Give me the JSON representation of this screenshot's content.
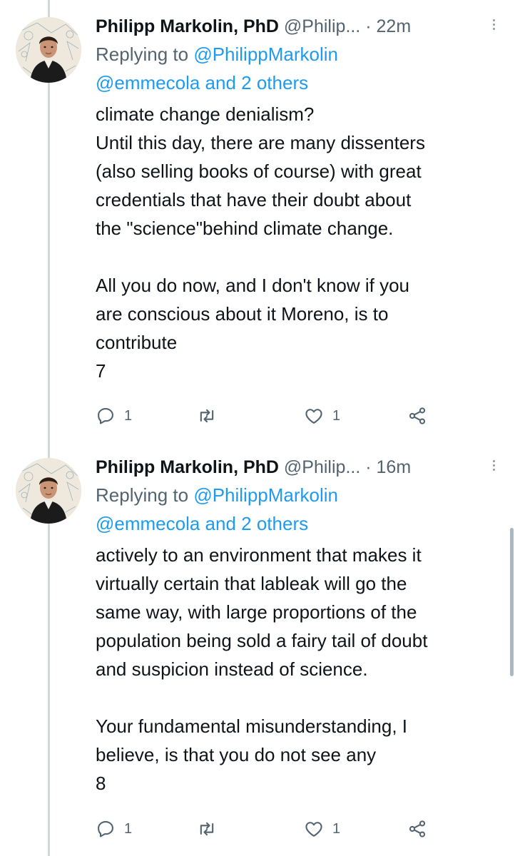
{
  "tweets": [
    {
      "author": {
        "name": "Philipp Markolin, PhD",
        "handle": "@Philip...",
        "time": "22m",
        "dot": "·"
      },
      "reply": {
        "prefix": "Replying to",
        "to": "@PhilippMarkolin",
        "mentions": "@emmecola and 2 others"
      },
      "lines": [
        "climate change denialism?",
        "Until this day, there are many dissenters",
        "(also selling books of course) with great",
        "credentials that have their doubt about",
        "the \"science\"behind climate change.",
        "",
        "All you do now, and I don't know if you",
        "are conscious about it Moreno, is to",
        "contribute",
        "7"
      ],
      "actions": {
        "replies": "1",
        "retweets": "",
        "likes": "1"
      }
    },
    {
      "author": {
        "name": "Philipp Markolin, PhD",
        "handle": "@Philip...",
        "time": "16m",
        "dot": "·"
      },
      "reply": {
        "prefix": "Replying to",
        "to": "@PhilippMarkolin",
        "mentions": "@emmecola and 2 others"
      },
      "lines": [
        "actively to an environment that makes it",
        "virtually certain that lableak will go the",
        "same way, with large proportions of the",
        "population being sold a fairy tail of doubt",
        "and suspicion instead of science.",
        "",
        "Your fundamental misunderstanding, I",
        "believe, is that you do not see any",
        "8"
      ],
      "actions": {
        "replies": "1",
        "retweets": "",
        "likes": "1"
      }
    }
  ],
  "colors": {
    "link": "#1d9bf0",
    "secondary_text": "#536471",
    "primary_text": "#0f1419",
    "thread_line": "#cfd9de"
  },
  "icons": {
    "reply": "reply-icon",
    "retweet": "retweet-icon",
    "like": "heart-icon",
    "share": "share-icon",
    "more": "more-icon"
  }
}
